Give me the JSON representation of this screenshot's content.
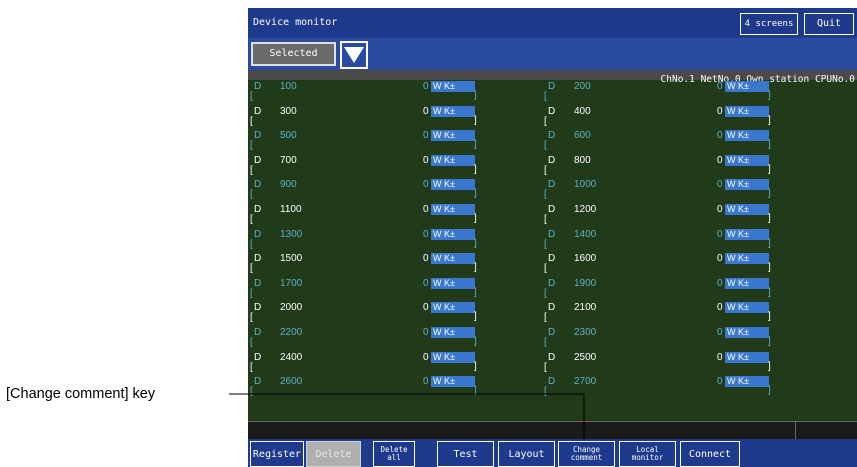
{
  "window": {
    "title": "Device monitor",
    "screens_button": "4 screens",
    "quit_button": "Quit"
  },
  "selector": {
    "selected_label": "Selected"
  },
  "info": {
    "station_text": "ChNo.1 NetNo.0 Own station CPUNo.0"
  },
  "format_badge": "W K±",
  "rows": [
    {
      "left": {
        "dev": "D",
        "addr": "100",
        "value": "0"
      },
      "right": {
        "dev": "D",
        "addr": "200",
        "value": "0"
      }
    },
    {
      "left": {
        "dev": "D",
        "addr": "300",
        "value": "0"
      },
      "right": {
        "dev": "D",
        "addr": "400",
        "value": "0"
      }
    },
    {
      "left": {
        "dev": "D",
        "addr": "500",
        "value": "0"
      },
      "right": {
        "dev": "D",
        "addr": "600",
        "value": "0"
      }
    },
    {
      "left": {
        "dev": "D",
        "addr": "700",
        "value": "0"
      },
      "right": {
        "dev": "D",
        "addr": "800",
        "value": "0"
      }
    },
    {
      "left": {
        "dev": "D",
        "addr": "900",
        "value": "0"
      },
      "right": {
        "dev": "D",
        "addr": "1000",
        "value": "0"
      }
    },
    {
      "left": {
        "dev": "D",
        "addr": "1100",
        "value": "0"
      },
      "right": {
        "dev": "D",
        "addr": "1200",
        "value": "0"
      }
    },
    {
      "left": {
        "dev": "D",
        "addr": "1300",
        "value": "0"
      },
      "right": {
        "dev": "D",
        "addr": "1400",
        "value": "0"
      }
    },
    {
      "left": {
        "dev": "D",
        "addr": "1500",
        "value": "0"
      },
      "right": {
        "dev": "D",
        "addr": "1600",
        "value": "0"
      }
    },
    {
      "left": {
        "dev": "D",
        "addr": "1700",
        "value": "0"
      },
      "right": {
        "dev": "D",
        "addr": "1900",
        "value": "0"
      }
    },
    {
      "left": {
        "dev": "D",
        "addr": "2000",
        "value": "0"
      },
      "right": {
        "dev": "D",
        "addr": "2100",
        "value": "0"
      }
    },
    {
      "left": {
        "dev": "D",
        "addr": "2200",
        "value": "0"
      },
      "right": {
        "dev": "D",
        "addr": "2300",
        "value": "0"
      }
    },
    {
      "left": {
        "dev": "D",
        "addr": "2400",
        "value": "0"
      },
      "right": {
        "dev": "D",
        "addr": "2500",
        "value": "0"
      }
    },
    {
      "left": {
        "dev": "D",
        "addr": "2600",
        "value": "0"
      },
      "right": {
        "dev": "D",
        "addr": "2700",
        "value": "0"
      }
    }
  ],
  "keys": {
    "register": "Register",
    "delete": "Delete",
    "delete_all": "Delete all",
    "test": "Test",
    "layout": "Layout",
    "change_comment": "Change comment",
    "local_monitor": "Local monitor",
    "connect": "Connect"
  },
  "callout": {
    "label": "[Change comment] key"
  },
  "colors": {
    "screen_bg": "#213a1a",
    "title_bar": "#1e3a8c",
    "format_badge": "#3a78d0",
    "alt_row_text": "#5fb0c4",
    "row_text": "#ffffff"
  }
}
